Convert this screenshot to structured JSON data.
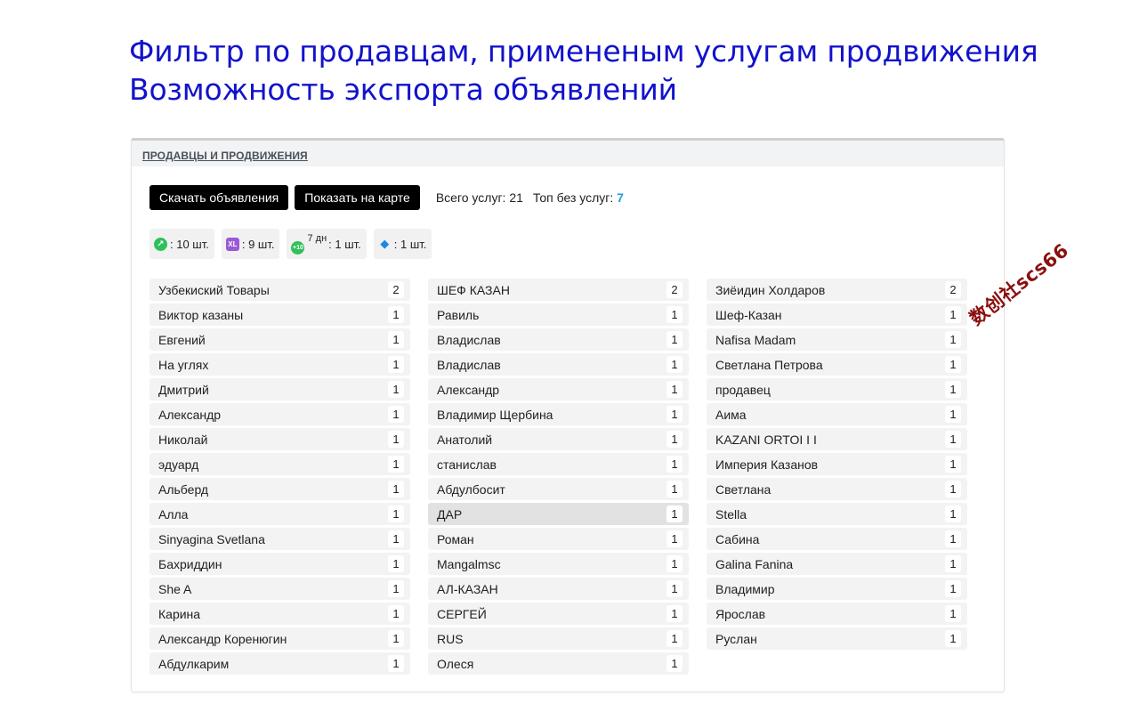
{
  "headline": {
    "line1": "Фильтр по продавцам, примененым услугам продвижения",
    "line2": "Возможность экспорта объявлений"
  },
  "panel": {
    "title": "ПРОДАВЦЫ И ПРОДВИЖЕНИЯ",
    "buttons": {
      "download": "Скачать объявления",
      "map": "Показать на карте"
    },
    "stats": {
      "total_label": "Всего услуг:",
      "total_value": "21",
      "top_label": "Топ без услуг:",
      "top_value": "7"
    },
    "badges": [
      {
        "icon": "up-arrow-icon",
        "text": ": 10 шт."
      },
      {
        "icon": "xl-icon",
        "text": ": 9 шт."
      },
      {
        "icon": "top-icon",
        "sup": "7 дн",
        "text": ": 1 шт."
      },
      {
        "icon": "pin-icon",
        "text": ": 1 шт."
      }
    ],
    "sellers_col1": [
      {
        "name": "Узбекиский Товары",
        "count": "2"
      },
      {
        "name": "Виктор казаны",
        "count": "1"
      },
      {
        "name": "Евгений",
        "count": "1"
      },
      {
        "name": "На углях",
        "count": "1"
      },
      {
        "name": "Дмитрий",
        "count": "1"
      },
      {
        "name": "Александр",
        "count": "1"
      },
      {
        "name": "Николай",
        "count": "1"
      },
      {
        "name": "эдуард",
        "count": "1"
      },
      {
        "name": "Альберд",
        "count": "1"
      },
      {
        "name": "Алла",
        "count": "1"
      },
      {
        "name": "Sinyagina Svetlana",
        "count": "1"
      },
      {
        "name": "Бахриддин",
        "count": "1"
      },
      {
        "name": "She A",
        "count": "1"
      },
      {
        "name": "Карина",
        "count": "1"
      },
      {
        "name": "Александр Коренюгин",
        "count": "1"
      },
      {
        "name": "Абдулкарим",
        "count": "1"
      }
    ],
    "sellers_col2": [
      {
        "name": "ШЕФ КАЗАН",
        "count": "2"
      },
      {
        "name": "Равиль",
        "count": "1"
      },
      {
        "name": "Владислав",
        "count": "1"
      },
      {
        "name": "Владислав",
        "count": "1"
      },
      {
        "name": "Александр",
        "count": "1"
      },
      {
        "name": "Владимир Щербина",
        "count": "1"
      },
      {
        "name": "Анатолий",
        "count": "1"
      },
      {
        "name": "станислав",
        "count": "1"
      },
      {
        "name": "Абдулбосит",
        "count": "1"
      },
      {
        "name": "ДАР",
        "count": "1"
      },
      {
        "name": "Роман",
        "count": "1"
      },
      {
        "name": "Mangalmsc",
        "count": "1"
      },
      {
        "name": "АЛ-КАЗАН",
        "count": "1"
      },
      {
        "name": "СЕРГЕЙ",
        "count": "1"
      },
      {
        "name": "RUS",
        "count": "1"
      },
      {
        "name": "Олеся",
        "count": "1"
      }
    ],
    "sellers_col3": [
      {
        "name": "Зиёидин Холдаров",
        "count": "2"
      },
      {
        "name": "Шеф-Казан",
        "count": "1"
      },
      {
        "name": "Nafisa Madam",
        "count": "1"
      },
      {
        "name": "Светлана Петрова",
        "count": "1"
      },
      {
        "name": "продавец",
        "count": "1"
      },
      {
        "name": "Аима",
        "count": "1"
      },
      {
        "name": "KAZANI ORTOI I I",
        "count": "1"
      },
      {
        "name": "Империя Казанов",
        "count": "1"
      },
      {
        "name": "Светлана",
        "count": "1"
      },
      {
        "name": "Stella",
        "count": "1"
      },
      {
        "name": "Сабина",
        "count": "1"
      },
      {
        "name": "Galina Fanina",
        "count": "1"
      },
      {
        "name": "Владимир",
        "count": "1"
      },
      {
        "name": "Ярослав",
        "count": "1"
      },
      {
        "name": "Руслан",
        "count": "1"
      }
    ]
  },
  "watermark": "数创社scs66",
  "colors": {
    "headline": "#1212cc",
    "accent": "#19a3d8",
    "watermark": "#8b0f0f"
  }
}
